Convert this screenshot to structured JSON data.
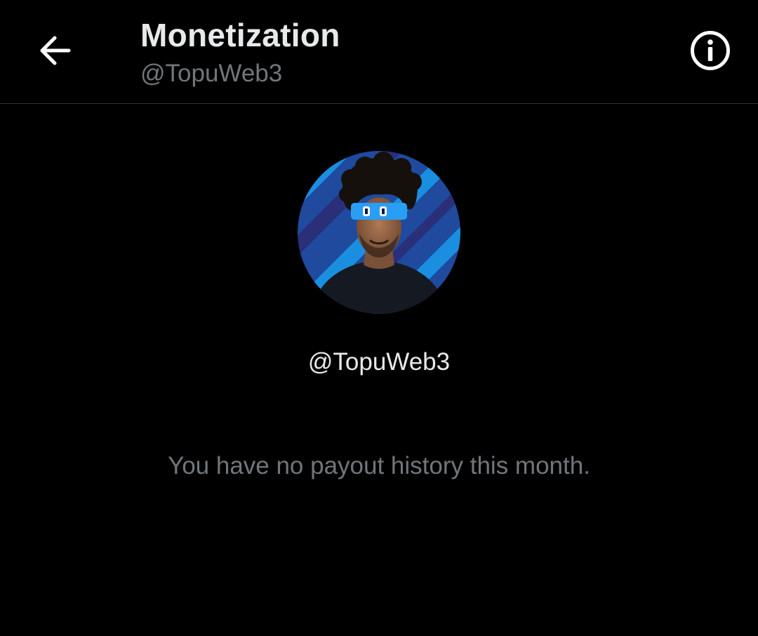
{
  "header": {
    "back_icon": "arrow-left-icon",
    "title": "Monetization",
    "subtitle": "@TopuWeb3",
    "info_icon": "info-circle-icon"
  },
  "profile": {
    "avatar_icon": "profile-avatar",
    "username": "@TopuWeb3"
  },
  "main": {
    "empty_message": "You have no payout history this month."
  },
  "colors": {
    "background": "#000000",
    "primary_text": "#e7e9ea",
    "secondary_text": "#71767b",
    "divider": "#2f3336",
    "accent_blue": "#1d9bf0"
  }
}
